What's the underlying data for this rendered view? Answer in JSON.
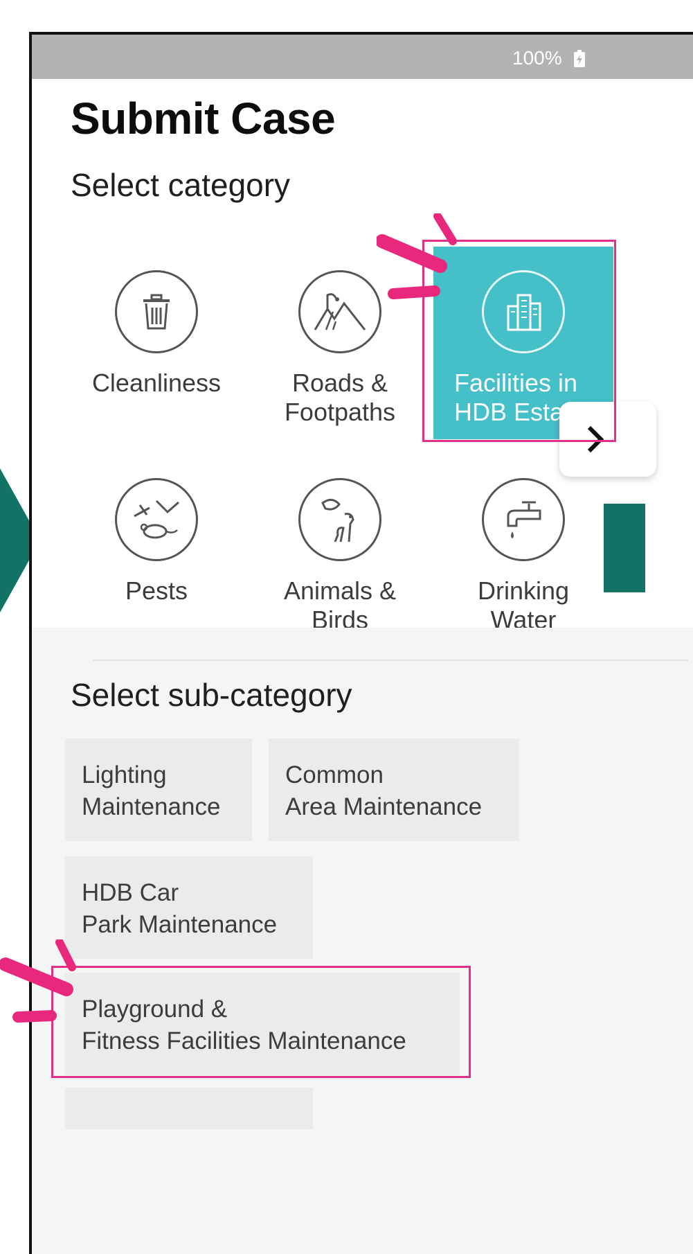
{
  "status_bar": {
    "battery_percent": "100%"
  },
  "page_title": "Submit Case",
  "category_section": {
    "title": "Select category",
    "categories": [
      {
        "label": "Cleanliness",
        "icon": "trash-bin-icon",
        "selected": false
      },
      {
        "label": "Roads &\nFootpaths",
        "icon": "road-mountain-icon",
        "selected": false
      },
      {
        "label": "Facilities in\nHDB Esta",
        "icon": "building-icon",
        "selected": true
      },
      {
        "label": "Pests",
        "icon": "pest-icon",
        "selected": false
      },
      {
        "label": "Animals &\nBirds",
        "icon": "animal-bird-icon",
        "selected": false
      },
      {
        "label": "Drinking\nWater",
        "icon": "water-tap-icon",
        "selected": false
      }
    ],
    "next_icon": "chevron-right-icon"
  },
  "subcategory_section": {
    "title": "Select sub-category",
    "subcategories": [
      {
        "label": "Lighting\nMaintenance"
      },
      {
        "label": "Common\nArea Maintenance"
      },
      {
        "label": "HDB Car\nPark Maintenance"
      },
      {
        "label": "Playground &\nFitness Facilities Maintenance"
      }
    ]
  },
  "colors": {
    "accent": "#45bfc8",
    "highlight": "#e0308a",
    "arrow": "#127266",
    "status_bar": "#b3b3b3"
  }
}
